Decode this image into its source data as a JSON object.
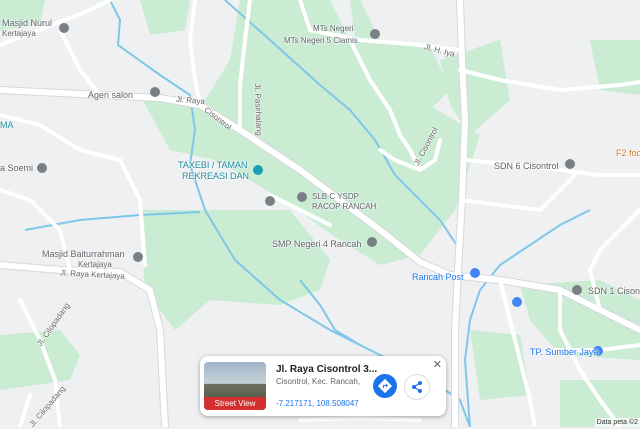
{
  "map": {
    "colors": {
      "land": "#eef0f1",
      "park": "#c9ecd3",
      "road": "#ffffff",
      "road_edge": "#d5d8dc",
      "water": "#7fc7e8",
      "poi_gray": "#7a7f86",
      "poi_blue": "#4285f4",
      "poi_teal": "#1e9cb3"
    },
    "labels": {
      "masjid_nurul": "Masjid Nurul",
      "kertajaya_top": "Kertajaya",
      "agen_salon": "Agen salon",
      "jl_raya_top": "Jl. Raya",
      "cisontrol": "Cisontrol",
      "jl_pasirhalang": "Jl. Pasirhalang",
      "mts_line1": "MTs Negeri",
      "mts_line2": "MTs Negeri 5 Ciamis",
      "jl_hijau": "Jl. H. Iya",
      "ma_fragment": "MA",
      "soemi": "a Soemi",
      "taman_line1": "TAXEBI / TAMAN",
      "taman_line2": "REKREASI DAN",
      "jl_cisontrol": "Jl. Cisontrol",
      "sdn6": "SDN 6 Cisontrol",
      "f2": "F2 foo",
      "slb_line1": "SLB C YSDP",
      "slb_line2": "RACOP RANCAH",
      "smp": "SMP Negeri 4 Rancah",
      "masjid_baiturrahman": "Masjid Baiturrahman",
      "kertajaya_mid": "Kertajaya",
      "jl_raya_kertajaya": "Jl. Raya Kertajaya",
      "rancah_post": "Rancah Post",
      "sdn1": "SDN 1 Cisont",
      "jl_cilopadang_1": "Jl. Cilopadang",
      "jl_cilopadang_2": "Jl. Cilopadang",
      "tp_sumber": "TP. Sumber Jaya"
    },
    "attribution": "Data peta ©2",
    "info_card": {
      "title": "Jl. Raya Cisontrol 3...",
      "subtitle": "Cisontrol, Kec. Rancah,",
      "coordinates": "-7.217171, 108.508047",
      "street_view_label": "Street View",
      "close_icon": "close-icon",
      "directions_icon": "directions-icon",
      "share_icon": "share-icon"
    }
  }
}
